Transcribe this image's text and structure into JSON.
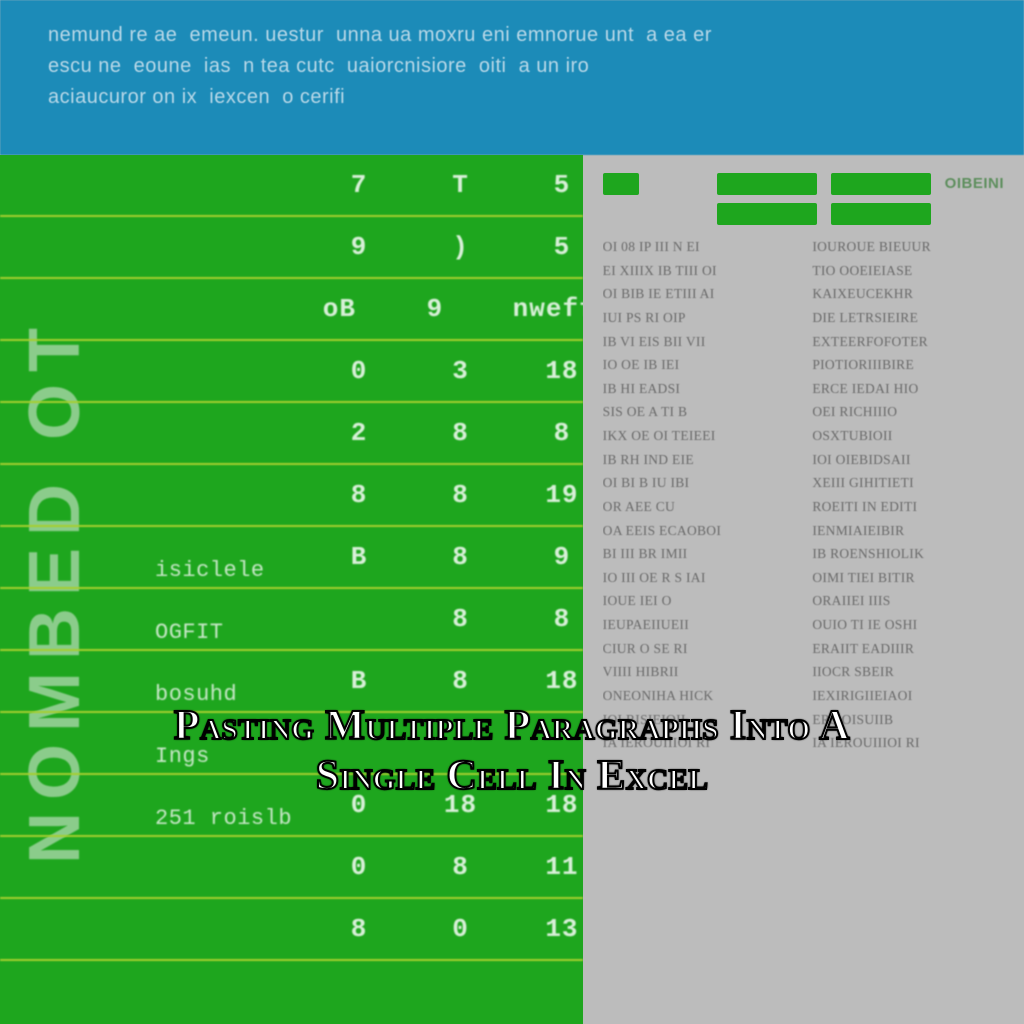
{
  "banner_text": "nemund re ae  emeun. uestur  unna ua moxru eni emnorue unt  a ea er\nescu ne  eoune  ias  n tea cutc  uaiorcnisiore  oiti  a un iro\naciaucuror on ix  iexcen  o cerifi",
  "left_vertical": "NOMBED OT",
  "rows": [
    {
      "c1": "",
      "c2": "7",
      "c3": "T",
      "c4": "5",
      "lab": ""
    },
    {
      "c1": "",
      "c2": "9",
      "c3": ")",
      "c4": "5",
      "lab": ""
    },
    {
      "c1": "",
      "c2": "oB",
      "c3": "9",
      "c4": "nweffa",
      "lab": ""
    },
    {
      "c1": "",
      "c2": "0",
      "c3": "3",
      "c4": "18",
      "lab": ""
    },
    {
      "c1": "",
      "c2": "2",
      "c3": "8",
      "c4": "8",
      "lab": ""
    },
    {
      "c1": "",
      "c2": "8",
      "c3": "8",
      "c4": "19",
      "lab": ""
    },
    {
      "c1": "",
      "c2": "B",
      "c3": "8",
      "c4": "9",
      "lab": "isiclele"
    },
    {
      "c1": "",
      "c2": "",
      "c3": "8",
      "c4": "8",
      "lab": "OGFIT"
    },
    {
      "c1": "",
      "c2": "B",
      "c3": "8",
      "c4": "18",
      "lab": "bosuhd"
    },
    {
      "c1": "",
      "c2": "",
      "c3": "",
      "c4": "",
      "lab": "Ings"
    },
    {
      "c1": "",
      "c2": "0",
      "c3": "18",
      "c4": "18",
      "lab": "251 roislb"
    },
    {
      "c1": "",
      "c2": "0",
      "c3": "8",
      "c4": "11",
      "lab": ""
    },
    {
      "c1": "",
      "c2": "8",
      "c3": "0",
      "c4": "13",
      "lab": ""
    }
  ],
  "right_label": "OIBEINI",
  "right_col1": [
    "OI 08 IP III N EI",
    "EI XIIIX IB TIII OI",
    "OI BIB IE ETIII AI",
    "IUI PS RI OIP",
    "IB VI EIS BII VII",
    "IO OE IB IEI",
    "IB HI EADSI",
    "SIS OE A TI B",
    "IKX OE OI TEIEEI",
    "IB RH IND EIE",
    "OI BI B IU IBI",
    "OR AEE CU",
    "OA EEIS ECAOBOI",
    "BI III BR IMII",
    "IO III OE R S IAI",
    "IOUE IEI O",
    "IEUPAEIIUEII",
    "CIUR O SE RI",
    "VIIII HIBRII",
    "ONEONIHA HICK",
    "IOI RISIEIOII",
    "IA IEROUIIIOI RI"
  ],
  "right_col2": [
    "IOUROUE BIEUUR",
    "TIO OOEIEIASE",
    "KAIXEUCEKHR",
    "DIE LETRSIEIRE",
    "EXTEERFOFOTER",
    "PIOTIORIIIBIRE",
    "ERCE IEDAI HIO",
    "OEI RICHIIIO",
    "OSXTUBIOII",
    "IOI OIEBIDSAII",
    "XEIII GIHITIETI",
    "ROEITI IN EDITI",
    "IENMIAIEIBIR",
    "IB ROENSHIOLIK",
    "OIMI TIEI BITIR",
    "ORAIIEI IIIS",
    "OUIO TI IE OSHI",
    "ERAIIT EADIIIR",
    "IIOCR SBEIR",
    "IEXIRIGIIEIAOI",
    "ERS OISUIIB",
    "IA IEROUIIIOI RI"
  ],
  "overlay_title": "Pasting Multiple Paragraphs Into A Single Cell In Excel"
}
